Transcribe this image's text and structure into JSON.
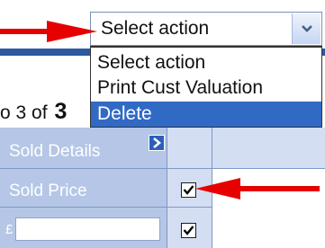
{
  "action_select": {
    "value": "Select action",
    "options": [
      "Select action",
      "Print Cust Valuation",
      "Delete"
    ],
    "highlighted_option": "Delete"
  },
  "pager": {
    "text": "o 3 of",
    "page": "3"
  },
  "table": {
    "sold_details_label": "Sold Details",
    "sold_price_label": "Sold Price",
    "currency_symbol": "£",
    "sold_price_value": ""
  },
  "colors": {
    "accent_blue": "#316ac5",
    "arrow_red": "#e60000",
    "column_header": "#b5c6e6"
  },
  "icons": {
    "select_button": "chevron-down-icon",
    "sold_details_button": "chevron-right-icon",
    "annotation": "red-arrow-icon"
  }
}
